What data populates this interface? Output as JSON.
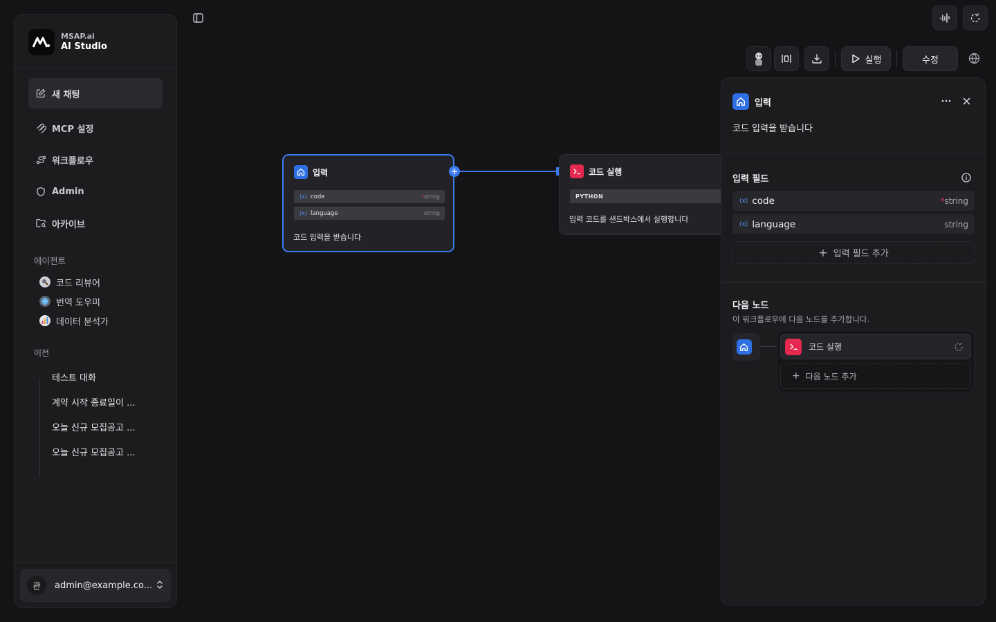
{
  "brand": {
    "small": "MSAP.ai",
    "title": "AI Studio"
  },
  "nav": [
    {
      "label": "새 채팅"
    },
    {
      "label": "MCP 설정"
    },
    {
      "label": "워크플로우"
    },
    {
      "label": "Admin"
    },
    {
      "label": "아카이브"
    }
  ],
  "agents": {
    "label": "에이전트",
    "items": [
      {
        "label": "코드 리뷰어"
      },
      {
        "label": "번역 도우미"
      },
      {
        "label": "데이터 분석가"
      }
    ]
  },
  "history": {
    "label": "이전",
    "items": [
      {
        "label": "테스트 대화"
      },
      {
        "label": "계약 시작 종료일이 ..."
      },
      {
        "label": "오늘 신규 모집공고 ..."
      },
      {
        "label": "오늘 신규 모집공고 ..."
      }
    ]
  },
  "user": {
    "avatar": "관",
    "email": "admin@example.co..."
  },
  "toolbar": {
    "run_label": "실행",
    "edit_label": "수정"
  },
  "canvas": {
    "input_node": {
      "title": "입력",
      "fields": [
        {
          "name": "code",
          "type": "string",
          "required": true
        },
        {
          "name": "language",
          "type": "string",
          "required": false
        }
      ],
      "description": "코드 입력을 받습니다"
    },
    "code_node": {
      "title": "코드 실행",
      "badge": "PYTHON",
      "description": "입력 코드를 샌드박스에서 실행합니다"
    }
  },
  "panel": {
    "title": "입력",
    "description": "코드 입력을 받습니다",
    "fields_heading": "입력 필드",
    "fields": [
      {
        "name": "code",
        "type": "string",
        "required": true
      },
      {
        "name": "language",
        "type": "string",
        "required": false
      }
    ],
    "add_field_label": "입력 필드 추가",
    "next_heading": "다음 노드",
    "next_sub": "이 워크플로우에 다음 노드를 추가합니다.",
    "next_item_label": "코드 실행",
    "next_add_label": "다음 노드 추가"
  },
  "colors": {
    "accent_blue": "#2f6fe4",
    "accent_red": "#e5284f",
    "selection": "#3b7cf0"
  }
}
